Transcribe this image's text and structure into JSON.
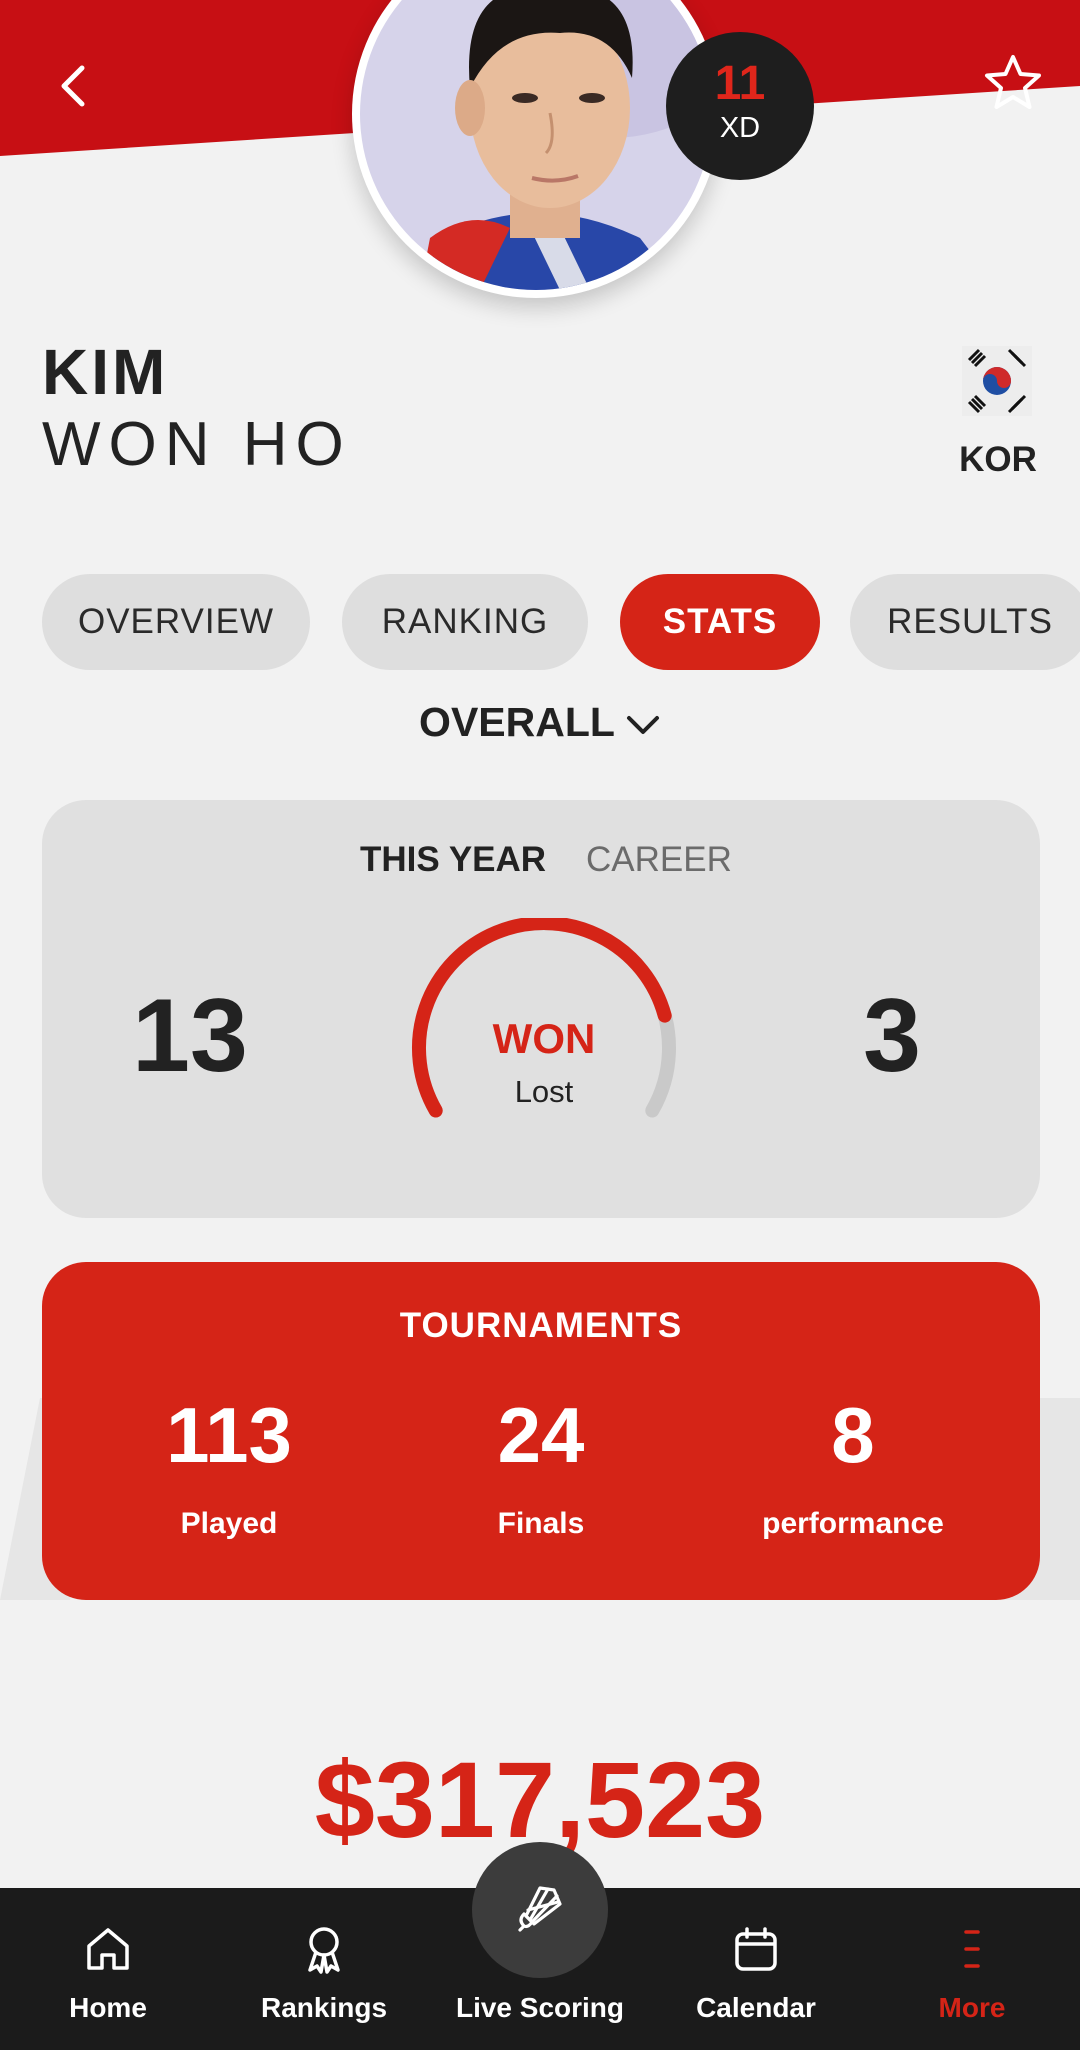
{
  "colors": {
    "accent": "#d52417",
    "dark": "#1e1e1e",
    "background": "#f2f2f2"
  },
  "header": {
    "back_icon": "chevron-left-icon",
    "favorite_icon": "star-outline-icon"
  },
  "player": {
    "first_name": "KIM",
    "last_name": "WON HO",
    "rank": "11",
    "event": "XD",
    "country": "KOR",
    "flag_icon": "south-korea-flag-icon"
  },
  "tabs": [
    {
      "label": "OVERVIEW",
      "active": false
    },
    {
      "label": "RANKING",
      "active": false
    },
    {
      "label": "STATS",
      "active": true
    },
    {
      "label": "RESULTS",
      "active": false
    }
  ],
  "filter": {
    "label": "OVERALL",
    "icon": "chevron-down-icon"
  },
  "stats": {
    "periods": [
      {
        "label": "THIS YEAR",
        "active": true
      },
      {
        "label": "CAREER",
        "active": false
      }
    ],
    "won": "13",
    "lost": "3",
    "won_label": "WON",
    "lost_label": "Lost",
    "win_fraction": 0.8125
  },
  "tournaments": {
    "title": "TOURNAMENTS",
    "items": [
      {
        "value": "113",
        "label": "Played"
      },
      {
        "value": "24",
        "label": "Finals"
      },
      {
        "value": "8",
        "label": "performance"
      }
    ]
  },
  "prize_money": "$317,523",
  "bottom_nav": [
    {
      "label": "Home",
      "icon": "home-icon",
      "active": false
    },
    {
      "label": "Rankings",
      "icon": "ribbon-icon",
      "active": false
    },
    {
      "label": "Live Scoring",
      "icon": "shuttlecock-icon",
      "active": false
    },
    {
      "label": "Calendar",
      "icon": "calendar-icon",
      "active": false
    },
    {
      "label": "More",
      "icon": "more-icon",
      "active": true
    }
  ]
}
